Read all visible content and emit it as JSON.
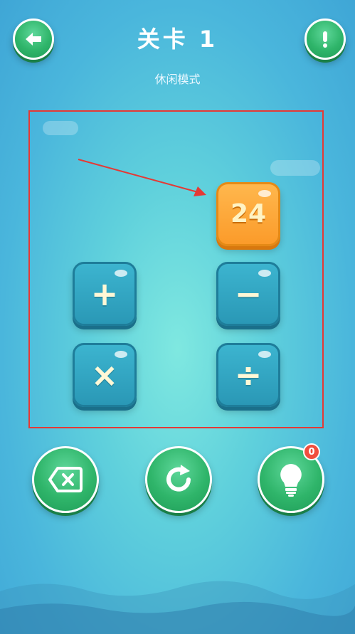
{
  "header": {
    "title": "关卡 1",
    "subtitle": "休闲模式"
  },
  "board": {
    "target_number": "24",
    "operators": {
      "plus": "+",
      "minus": "−",
      "times": "×",
      "divide": "÷"
    }
  },
  "controls": {
    "hint_count": "0"
  },
  "icons": {
    "back": "back-arrow-icon",
    "help": "exclamation-icon",
    "delete": "backspace-icon",
    "restart": "refresh-icon",
    "hint": "lightbulb-icon"
  },
  "colors": {
    "button_green": "#2fb56a",
    "operator_tile": "#2a98b6",
    "number_tile": "#fb9b2a",
    "highlight_border": "#e53935",
    "badge": "#f04e3e"
  }
}
